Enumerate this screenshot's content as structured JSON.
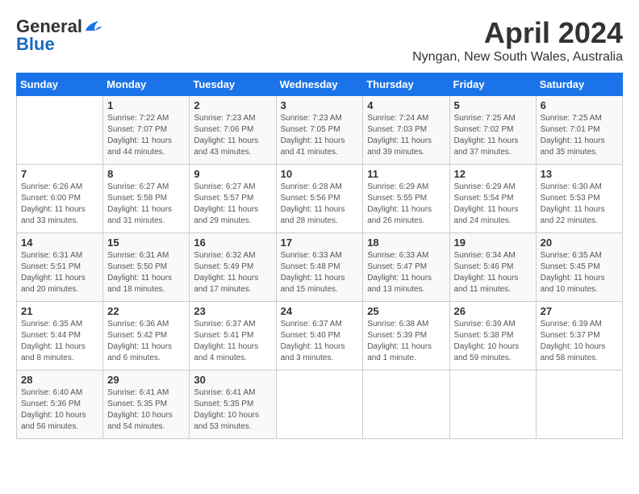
{
  "header": {
    "logo_line1": "General",
    "logo_line2": "Blue",
    "month_title": "April 2024",
    "location": "Nyngan, New South Wales, Australia"
  },
  "days_of_week": [
    "Sunday",
    "Monday",
    "Tuesday",
    "Wednesday",
    "Thursday",
    "Friday",
    "Saturday"
  ],
  "weeks": [
    [
      {
        "num": "",
        "sunrise": "",
        "sunset": "",
        "daylight": ""
      },
      {
        "num": "1",
        "sunrise": "Sunrise: 7:22 AM",
        "sunset": "Sunset: 7:07 PM",
        "daylight": "Daylight: 11 hours and 44 minutes."
      },
      {
        "num": "2",
        "sunrise": "Sunrise: 7:23 AM",
        "sunset": "Sunset: 7:06 PM",
        "daylight": "Daylight: 11 hours and 43 minutes."
      },
      {
        "num": "3",
        "sunrise": "Sunrise: 7:23 AM",
        "sunset": "Sunset: 7:05 PM",
        "daylight": "Daylight: 11 hours and 41 minutes."
      },
      {
        "num": "4",
        "sunrise": "Sunrise: 7:24 AM",
        "sunset": "Sunset: 7:03 PM",
        "daylight": "Daylight: 11 hours and 39 minutes."
      },
      {
        "num": "5",
        "sunrise": "Sunrise: 7:25 AM",
        "sunset": "Sunset: 7:02 PM",
        "daylight": "Daylight: 11 hours and 37 minutes."
      },
      {
        "num": "6",
        "sunrise": "Sunrise: 7:25 AM",
        "sunset": "Sunset: 7:01 PM",
        "daylight": "Daylight: 11 hours and 35 minutes."
      }
    ],
    [
      {
        "num": "7",
        "sunrise": "Sunrise: 6:26 AM",
        "sunset": "Sunset: 6:00 PM",
        "daylight": "Daylight: 11 hours and 33 minutes."
      },
      {
        "num": "8",
        "sunrise": "Sunrise: 6:27 AM",
        "sunset": "Sunset: 5:58 PM",
        "daylight": "Daylight: 11 hours and 31 minutes."
      },
      {
        "num": "9",
        "sunrise": "Sunrise: 6:27 AM",
        "sunset": "Sunset: 5:57 PM",
        "daylight": "Daylight: 11 hours and 29 minutes."
      },
      {
        "num": "10",
        "sunrise": "Sunrise: 6:28 AM",
        "sunset": "Sunset: 5:56 PM",
        "daylight": "Daylight: 11 hours and 28 minutes."
      },
      {
        "num": "11",
        "sunrise": "Sunrise: 6:29 AM",
        "sunset": "Sunset: 5:55 PM",
        "daylight": "Daylight: 11 hours and 26 minutes."
      },
      {
        "num": "12",
        "sunrise": "Sunrise: 6:29 AM",
        "sunset": "Sunset: 5:54 PM",
        "daylight": "Daylight: 11 hours and 24 minutes."
      },
      {
        "num": "13",
        "sunrise": "Sunrise: 6:30 AM",
        "sunset": "Sunset: 5:53 PM",
        "daylight": "Daylight: 11 hours and 22 minutes."
      }
    ],
    [
      {
        "num": "14",
        "sunrise": "Sunrise: 6:31 AM",
        "sunset": "Sunset: 5:51 PM",
        "daylight": "Daylight: 11 hours and 20 minutes."
      },
      {
        "num": "15",
        "sunrise": "Sunrise: 6:31 AM",
        "sunset": "Sunset: 5:50 PM",
        "daylight": "Daylight: 11 hours and 18 minutes."
      },
      {
        "num": "16",
        "sunrise": "Sunrise: 6:32 AM",
        "sunset": "Sunset: 5:49 PM",
        "daylight": "Daylight: 11 hours and 17 minutes."
      },
      {
        "num": "17",
        "sunrise": "Sunrise: 6:33 AM",
        "sunset": "Sunset: 5:48 PM",
        "daylight": "Daylight: 11 hours and 15 minutes."
      },
      {
        "num": "18",
        "sunrise": "Sunrise: 6:33 AM",
        "sunset": "Sunset: 5:47 PM",
        "daylight": "Daylight: 11 hours and 13 minutes."
      },
      {
        "num": "19",
        "sunrise": "Sunrise: 6:34 AM",
        "sunset": "Sunset: 5:46 PM",
        "daylight": "Daylight: 11 hours and 11 minutes."
      },
      {
        "num": "20",
        "sunrise": "Sunrise: 6:35 AM",
        "sunset": "Sunset: 5:45 PM",
        "daylight": "Daylight: 11 hours and 10 minutes."
      }
    ],
    [
      {
        "num": "21",
        "sunrise": "Sunrise: 6:35 AM",
        "sunset": "Sunset: 5:44 PM",
        "daylight": "Daylight: 11 hours and 8 minutes."
      },
      {
        "num": "22",
        "sunrise": "Sunrise: 6:36 AM",
        "sunset": "Sunset: 5:42 PM",
        "daylight": "Daylight: 11 hours and 6 minutes."
      },
      {
        "num": "23",
        "sunrise": "Sunrise: 6:37 AM",
        "sunset": "Sunset: 5:41 PM",
        "daylight": "Daylight: 11 hours and 4 minutes."
      },
      {
        "num": "24",
        "sunrise": "Sunrise: 6:37 AM",
        "sunset": "Sunset: 5:40 PM",
        "daylight": "Daylight: 11 hours and 3 minutes."
      },
      {
        "num": "25",
        "sunrise": "Sunrise: 6:38 AM",
        "sunset": "Sunset: 5:39 PM",
        "daylight": "Daylight: 11 hours and 1 minute."
      },
      {
        "num": "26",
        "sunrise": "Sunrise: 6:39 AM",
        "sunset": "Sunset: 5:38 PM",
        "daylight": "Daylight: 10 hours and 59 minutes."
      },
      {
        "num": "27",
        "sunrise": "Sunrise: 6:39 AM",
        "sunset": "Sunset: 5:37 PM",
        "daylight": "Daylight: 10 hours and 58 minutes."
      }
    ],
    [
      {
        "num": "28",
        "sunrise": "Sunrise: 6:40 AM",
        "sunset": "Sunset: 5:36 PM",
        "daylight": "Daylight: 10 hours and 56 minutes."
      },
      {
        "num": "29",
        "sunrise": "Sunrise: 6:41 AM",
        "sunset": "Sunset: 5:35 PM",
        "daylight": "Daylight: 10 hours and 54 minutes."
      },
      {
        "num": "30",
        "sunrise": "Sunrise: 6:41 AM",
        "sunset": "Sunset: 5:35 PM",
        "daylight": "Daylight: 10 hours and 53 minutes."
      },
      {
        "num": "",
        "sunrise": "",
        "sunset": "",
        "daylight": ""
      },
      {
        "num": "",
        "sunrise": "",
        "sunset": "",
        "daylight": ""
      },
      {
        "num": "",
        "sunrise": "",
        "sunset": "",
        "daylight": ""
      },
      {
        "num": "",
        "sunrise": "",
        "sunset": "",
        "daylight": ""
      }
    ]
  ]
}
